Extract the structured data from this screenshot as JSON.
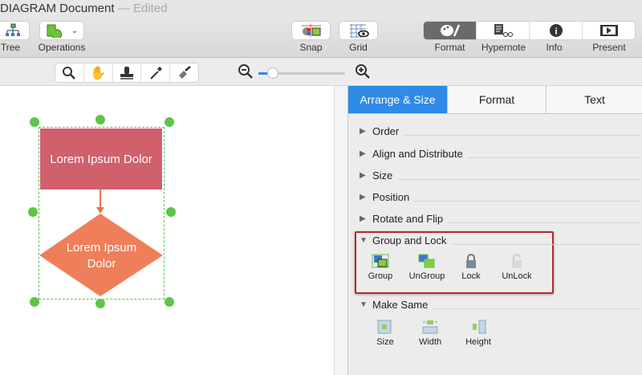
{
  "window": {
    "title": "DIAGRAM Document",
    "status": "— Edited"
  },
  "toolbar": {
    "tree": "Tree",
    "operations": "Operations",
    "snap": "Snap",
    "grid": "Grid",
    "format": "Format",
    "hypernote": "Hypernote",
    "info": "Info",
    "present": "Present"
  },
  "tools": [
    "zoom-tool",
    "hand-tool",
    "stamp-tool",
    "eyedropper-tool",
    "brush-tool"
  ],
  "zoom": {
    "level": 0.1
  },
  "canvas": {
    "rect_text": "Lorem Ipsum Dolor",
    "diamond_line1": "Lorem Ipsum",
    "diamond_line2": "Dolor",
    "colors": {
      "rect": "#d0606a",
      "diamond": "#ef7f5a",
      "handle": "#5ec44a"
    }
  },
  "panel": {
    "tabs": [
      "Arrange & Size",
      "Format",
      "Text"
    ],
    "sections": [
      "Order",
      "Align and Distribute",
      "Size",
      "Position",
      "Rotate and Flip",
      "Group and Lock",
      "Make Same"
    ],
    "group_lock": [
      "Group",
      "UnGroup",
      "Lock",
      "UnLock"
    ],
    "make_same": [
      "Size",
      "Width",
      "Height"
    ]
  },
  "accent": "#2f8ae8"
}
